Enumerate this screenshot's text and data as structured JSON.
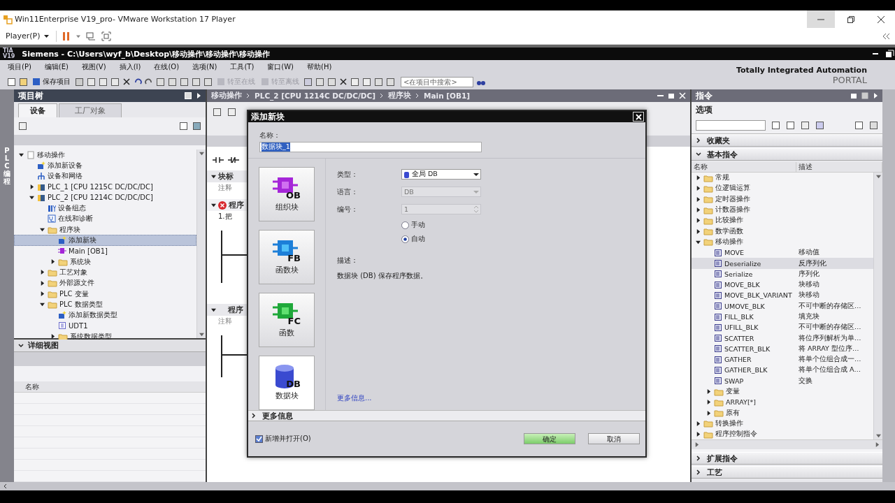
{
  "vm_window": {
    "title": "Win11Enterprise V19_pro- VMware Workstation 17 Player",
    "player_menu": "Player(P)"
  },
  "app": {
    "logo": [
      "TIA",
      "V19"
    ],
    "title": "Siemens  -  C:\\Users\\wyf_b\\Desktop\\移动操作\\移动操作\\移动操作",
    "brand": "Totally Integrated Automation",
    "brand_sub": "PORTAL"
  },
  "menu": [
    "项目(P)",
    "编辑(E)",
    "视图(V)",
    "插入(I)",
    "在线(O)",
    "选项(N)",
    "工具(T)",
    "窗口(W)",
    "帮助(H)"
  ],
  "toolbar": {
    "buttons": [
      {
        "label": "保存项目",
        "disabled": false
      },
      {
        "label": "转至在线",
        "disabled": true
      },
      {
        "label": "转至离线",
        "disabled": true
      }
    ],
    "search_placeholder": "<在项目中搜索>"
  },
  "side_strip": {
    "label": "PLC 编程"
  },
  "project_tree": {
    "title": "项目树",
    "tabs": [
      {
        "label": "设备",
        "selected": true
      },
      {
        "label": "工厂对象",
        "selected": false
      }
    ],
    "items": [
      {
        "label": "移动操作",
        "kind": "project",
        "expanded": true,
        "selected": false,
        "children": [
          {
            "label": "添加新设备",
            "kind": "add",
            "selected": false
          },
          {
            "label": "设备和网络",
            "kind": "network",
            "selected": false
          },
          {
            "label": "PLC_1 [CPU 1215C DC/DC/DC]",
            "kind": "plc",
            "expanded": false,
            "selected": false
          },
          {
            "label": "PLC_2 [CPU 1214C DC/DC/DC]",
            "kind": "plc",
            "expanded": true,
            "selected": false,
            "children": [
              {
                "label": "设备组态",
                "kind": "config",
                "selected": false
              },
              {
                "label": "在线和诊断",
                "kind": "diag",
                "selected": false
              },
              {
                "label": "程序块",
                "kind": "folder",
                "expanded": true,
                "selected": false,
                "children": [
                  {
                    "label": "添加新块",
                    "kind": "add",
                    "selected": true
                  },
                  {
                    "label": "Main [OB1]",
                    "kind": "block",
                    "selected": false
                  },
                  {
                    "label": "系统块",
                    "kind": "folder",
                    "expanded": false,
                    "selected": false
                  }
                ]
              },
              {
                "label": "工艺对象",
                "kind": "folder",
                "expanded": false,
                "selected": false
              },
              {
                "label": "外部源文件",
                "kind": "folder",
                "expanded": false,
                "selected": false
              },
              {
                "label": "PLC 变量",
                "kind": "folder",
                "expanded": false,
                "selected": false
              },
              {
                "label": "PLC 数据类型",
                "kind": "folder",
                "expanded": true,
                "selected": false,
                "children": [
                  {
                    "label": "添加新数据类型",
                    "kind": "add",
                    "selected": false
                  },
                  {
                    "label": "UDT1",
                    "kind": "udt",
                    "selected": false
                  },
                  {
                    "label": "系统数据类型",
                    "kind": "folder",
                    "expanded": false,
                    "selected": false
                  }
                ]
              }
            ]
          }
        ]
      }
    ]
  },
  "details": {
    "title": "详细视图",
    "expanded": true,
    "columns": [
      "名称"
    ]
  },
  "editor": {
    "breadcrumb": [
      "移动操作",
      "PLC_2 [CPU 1214C DC/DC/DC]",
      "程序块",
      "Main [OB1]"
    ],
    "block_title": "块标",
    "block_comment": "注释",
    "networks": [
      {
        "title": "程序",
        "error": true,
        "text": "1.把"
      },
      {
        "title": "程序",
        "error": false,
        "text": "注释"
      }
    ]
  },
  "dialog": {
    "title": "添加新块",
    "name_label": "名称：",
    "name_value": "数据块_1",
    "name_selected": true,
    "block_types": [
      {
        "label": "组织块",
        "code": "OB",
        "kind": "ob",
        "selected": false
      },
      {
        "label": "函数块",
        "code": "FB",
        "kind": "fb",
        "selected": false
      },
      {
        "label": "函数",
        "code": "FC",
        "kind": "fc",
        "selected": false
      },
      {
        "label": "数据块",
        "code": "DB",
        "kind": "db",
        "selected": true
      }
    ],
    "fields": [
      {
        "label": "类型：",
        "value": "全局 DB",
        "kind": "dropdown",
        "disabled": false
      },
      {
        "label": "语言：",
        "value": "DB",
        "kind": "dropdown",
        "disabled": true
      },
      {
        "label": "编号：",
        "value": "1",
        "kind": "spinner",
        "disabled": true
      }
    ],
    "numbering": [
      {
        "label": "手动",
        "selected": false
      },
      {
        "label": "自动",
        "selected": true
      }
    ],
    "description_label": "描述：",
    "description": "数据块 (DB) 保存程序数据。",
    "more_link": "更多信息...",
    "more_section": {
      "label": "更多信息",
      "expanded": false
    },
    "open_checkbox": {
      "label": "新增并打开(O)",
      "checked": true
    },
    "buttons": [
      {
        "label": "确定",
        "kind": "primary"
      },
      {
        "label": "取消",
        "kind": "secondary"
      }
    ]
  },
  "instructions": {
    "title": "指令",
    "options_label": "选项",
    "columns": [
      "名称",
      "描述"
    ],
    "sections": [
      {
        "label": "收藏夹",
        "expanded": false
      },
      {
        "label": "基本指令",
        "expanded": true,
        "items": [
          {
            "label": "常规",
            "kind": "folder",
            "expanded": false,
            "selected": false
          },
          {
            "label": "位逻辑运算",
            "kind": "folder",
            "expanded": false,
            "selected": false
          },
          {
            "label": "定时器操作",
            "kind": "folder",
            "expanded": false,
            "selected": false
          },
          {
            "label": "计数器操作",
            "kind": "folder",
            "expanded": false,
            "selected": false
          },
          {
            "label": "比较操作",
            "kind": "folder",
            "expanded": false,
            "selected": false
          },
          {
            "label": "数学函数",
            "kind": "folder",
            "expanded": false,
            "selected": false
          },
          {
            "label": "移动操作",
            "kind": "folder",
            "expanded": true,
            "selected": false,
            "children": [
              {
                "label": "MOVE",
                "description": "移动值",
                "kind": "instr",
                "selected": false
              },
              {
                "label": "Deserialize",
                "description": "反序列化",
                "kind": "instr",
                "selected": true
              },
              {
                "label": "Serialize",
                "description": "序列化",
                "kind": "instr",
                "selected": false
              },
              {
                "label": "MOVE_BLK",
                "description": "块移动",
                "kind": "instr",
                "selected": false
              },
              {
                "label": "MOVE_BLK_VARIANT",
                "description": "块移动",
                "kind": "instr",
                "selected": false
              },
              {
                "label": "UMOVE_BLK",
                "description": "不可中断的存储区…",
                "kind": "instr",
                "selected": false
              },
              {
                "label": "FILL_BLK",
                "description": "填充块",
                "kind": "instr",
                "selected": false
              },
              {
                "label": "UFILL_BLK",
                "description": "不可中断的存储区…",
                "kind": "instr",
                "selected": false
              },
              {
                "label": "SCATTER",
                "description": "将位序列解析为单…",
                "kind": "instr",
                "selected": false
              },
              {
                "label": "SCATTER_BLK",
                "description": "将 ARRAY 型位序…",
                "kind": "instr",
                "selected": false
              },
              {
                "label": "GATHER",
                "description": "将单个位组合成一…",
                "kind": "instr",
                "selected": false
              },
              {
                "label": "GATHER_BLK",
                "description": "将单个位组合成 A…",
                "kind": "instr",
                "selected": false
              },
              {
                "label": "SWAP",
                "description": "交换",
                "kind": "instr",
                "selected": false
              },
              {
                "label": "变量",
                "kind": "folder",
                "expanded": false,
                "selected": false
              },
              {
                "label": "ARRAY[*]",
                "kind": "folder",
                "expanded": false,
                "selected": false
              },
              {
                "label": "原有",
                "kind": "folder",
                "expanded": false,
                "selected": false
              }
            ]
          },
          {
            "label": "转换操作",
            "kind": "folder",
            "expanded": false,
            "selected": false
          },
          {
            "label": "程序控制指令",
            "kind": "folder",
            "expanded": false,
            "selected": false
          }
        ]
      },
      {
        "label": "扩展指令",
        "expanded": false
      },
      {
        "label": "工艺",
        "expanded": false
      }
    ]
  }
}
